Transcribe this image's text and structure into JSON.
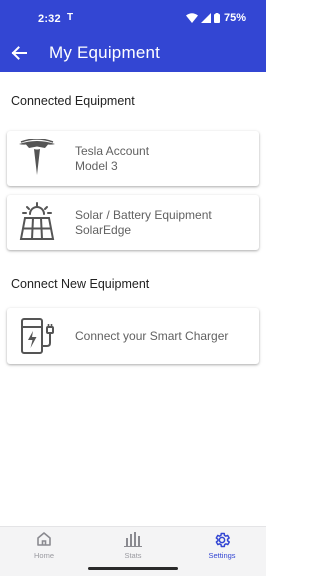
{
  "status_bar": {
    "time": "2:32",
    "tesla_glyph": "T",
    "battery": "75%"
  },
  "app_bar": {
    "title": "My Equipment",
    "back_icon": "arrow-left-icon"
  },
  "connected_section": {
    "heading": "Connected Equipment",
    "items": [
      {
        "icon": "tesla-logo-icon",
        "line1": "Tesla Account",
        "line2": "Model 3"
      },
      {
        "icon": "solar-panel-icon",
        "line1": "Solar / Battery Equipment",
        "line2": "SolarEdge"
      }
    ]
  },
  "connect_new_section": {
    "heading": "Connect New Equipment",
    "items": [
      {
        "icon": "ev-charger-icon",
        "label": "Connect your Smart Charger"
      }
    ]
  },
  "bottom_nav": {
    "items": [
      {
        "icon": "home-icon",
        "label": "Home",
        "active": false
      },
      {
        "icon": "stats-icon",
        "label": "Stats",
        "active": false
      },
      {
        "icon": "settings-gear-icon",
        "label": "Settings",
        "active": true
      }
    ]
  },
  "colors": {
    "primary": "#3346d3",
    "card_text": "#616161",
    "nav_inactive": "#9a9aa0"
  }
}
